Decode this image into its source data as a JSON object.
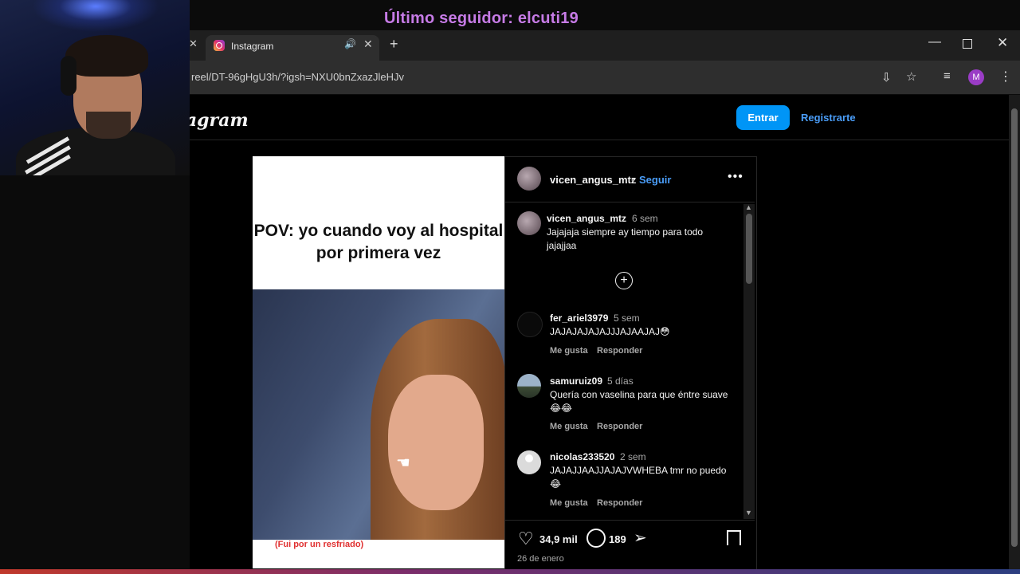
{
  "overlay": {
    "title": "Último seguidor: elcuti19"
  },
  "browser": {
    "tab_title": "Instagram",
    "url": "reel/DT-96gHgU3h/?igsh=NXU0bnZxazJleHJv",
    "profile_initial": "M"
  },
  "instagram": {
    "logo": "Instagram",
    "login_label": "Entrar",
    "signup_label": "Registrarte"
  },
  "reel": {
    "caption": "POV: yo cuando voy al hospital por primera vez",
    "subtitle": "(Fui por un resfriado)"
  },
  "post": {
    "author": "vicen_angus_mtz",
    "separator": "•",
    "follow_label": "Seguir",
    "caption_user": "vicen_angus_mtz",
    "caption_time": "6 sem",
    "caption_text": "Jajajaja siempre ay tiempo para todo jajajjaa",
    "comments": [
      {
        "user": "fer_ariel3979",
        "time": "5 sem",
        "text": "JAJAJAJAJAJJJAJAAJAJ😳",
        "like": "Me gusta",
        "reply": "Responder"
      },
      {
        "user": "samuruiz09",
        "time": "5 días",
        "text": "Quería con vaselina para que éntre suave 😂😂",
        "like": "Me gusta",
        "reply": "Responder"
      },
      {
        "user": "nicolas233520",
        "time": "2 sem",
        "text": "JAJAJJAAJJAJAJVWHEBA tmr no puedo 😂",
        "like": "Me gusta",
        "reply": "Responder"
      }
    ],
    "likes": "34,9 mil",
    "comment_count": "189",
    "date": "26 de enero"
  },
  "colors": {
    "accent": "#0095f6",
    "link": "#4a9df8",
    "overlay_text": "#c67be6"
  },
  "icons": [
    "close-icon",
    "audio-icon",
    "plus-icon",
    "install-icon",
    "star-icon",
    "media-icon",
    "kebab-icon",
    "heart-icon",
    "comment-icon",
    "share-icon",
    "bookmark-icon",
    "more-icon",
    "add-circle-icon"
  ]
}
